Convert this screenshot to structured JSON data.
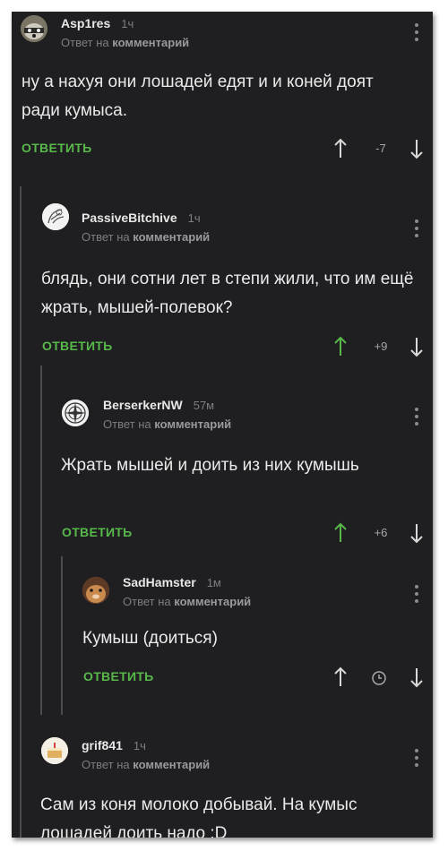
{
  "comments": [
    {
      "username": "Asp1res",
      "time": "1ч",
      "reply_prefix": "Ответ на",
      "reply_target": "комментарий",
      "text": "ну а нахуя они лошадей едят и и коней доят ради кумыса.",
      "reply_label": "ОТВЕТИТЬ",
      "score": "-7"
    },
    {
      "username": "PassiveBitchive",
      "time": "1ч",
      "reply_prefix": "Ответ на",
      "reply_target": "комментарий",
      "text": "блядь, они сотни лет в степи жили, что им ещё жрать, мышей-полевок?",
      "reply_label": "ОТВЕТИТЬ",
      "score": "+9"
    },
    {
      "username": "BerserkerNW",
      "time": "57м",
      "reply_prefix": "Ответ на",
      "reply_target": "комментарий",
      "text": "Жрать мышей и доить из них кумышь",
      "reply_label": "ОТВЕТИТЬ",
      "score": "+6"
    },
    {
      "username": "SadHamster",
      "time": "1м",
      "reply_prefix": "Ответ на",
      "reply_target": "комментарий",
      "text": "Кумыш (доиться)",
      "reply_label": "ОТВЕТИТЬ",
      "score": ""
    },
    {
      "username": "grif841",
      "time": "1ч",
      "reply_prefix": "Ответ на",
      "reply_target": "комментарий",
      "text": "Сам из коня молоко добывай. На кумыс лошадей доить надо :D"
    }
  ],
  "colors": {
    "background": "#1f1f22",
    "accent_green": "#58b84a",
    "text": "#eaeaea",
    "muted": "#7d7d82",
    "thread_line": "#4b4b50"
  }
}
